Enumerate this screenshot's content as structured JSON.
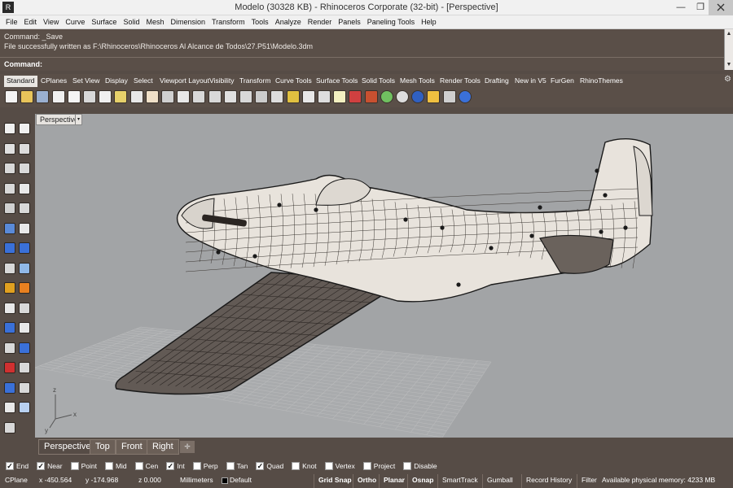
{
  "window": {
    "title": "Modelo (30328 KB) - Rhinoceros Corporate (32-bit) - [Perspective]",
    "logo": "R",
    "min_glyph": "—",
    "max_glyph": "❐",
    "close_glyph": ""
  },
  "menu": {
    "items": [
      "File",
      "Edit",
      "View",
      "Curve",
      "Surface",
      "Solid",
      "Mesh",
      "Dimension",
      "Transform",
      "Tools",
      "Analyze",
      "Render",
      "Panels",
      "Paneling Tools",
      "Help"
    ]
  },
  "command": {
    "history_line1": "Command: _Save",
    "history_line2": "File successfully written as F:\\Rhinoceros\\Rhinoceros Al Alcance de Todos\\27.P51\\Modelo.3dm",
    "prompt": "Command:",
    "scroll_up": "▲",
    "scroll_down": "▼"
  },
  "toolbar_tabs": [
    "Standard",
    "CPlanes",
    "Set View",
    "Display",
    "Select",
    "Viewport Layout",
    "Visibility",
    "Transform",
    "Curve Tools",
    "Surface Tools",
    "Solid Tools",
    "Mesh Tools",
    "Render Tools",
    "Drafting",
    "New in V5",
    "FurGen",
    "RhinoThemes"
  ],
  "toolbar_gear": "⚙",
  "viewport": {
    "name": "Perspective",
    "dropdown_glyph": "▾"
  },
  "viewport_tabs": [
    "Perspective",
    "Top",
    "Front",
    "Right"
  ],
  "viewport_add": "✛",
  "osnap": [
    {
      "label": "End",
      "checked": true
    },
    {
      "label": "Near",
      "checked": true
    },
    {
      "label": "Point",
      "checked": false
    },
    {
      "label": "Mid",
      "checked": false
    },
    {
      "label": "Cen",
      "checked": false
    },
    {
      "label": "Int",
      "checked": true
    },
    {
      "label": "Perp",
      "checked": false
    },
    {
      "label": "Tan",
      "checked": false
    },
    {
      "label": "Quad",
      "checked": true
    },
    {
      "label": "Knot",
      "checked": false
    },
    {
      "label": "Vertex",
      "checked": false
    },
    {
      "label": "Project",
      "checked": false
    },
    {
      "label": "Disable",
      "checked": false
    }
  ],
  "status": {
    "cplane": "CPlane",
    "x": "x -450.564",
    "y": "y -174.968",
    "z": "z 0.000",
    "units": "Millimeters",
    "layer": "Default",
    "grid_snap": "Grid Snap",
    "ortho": "Ortho",
    "planar": "Planar",
    "osnap": "Osnap",
    "smarttrack": "SmartTrack",
    "gumball": "Gumball",
    "record_history": "Record History",
    "filter": "Filter",
    "memory": "Available physical memory: 4233 MB"
  },
  "colors": {
    "chrome": "#564c46",
    "viewport_bg": "#a2a4a6",
    "model_fill": "#e8e3dc",
    "wing_fill": "#625a55"
  }
}
